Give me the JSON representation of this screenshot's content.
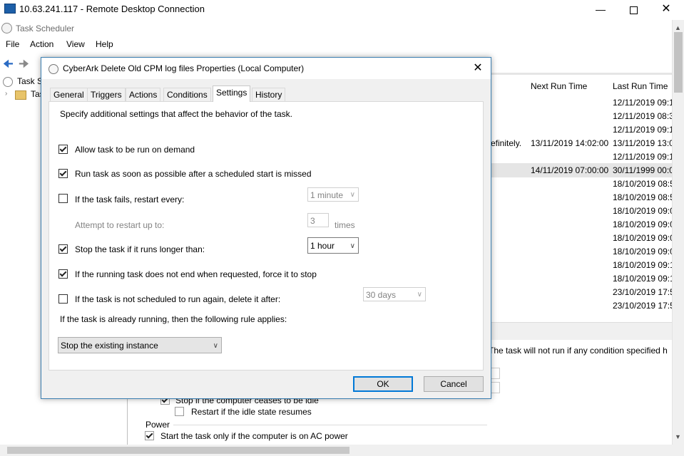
{
  "rdp": {
    "title": "10.63.241.117 - Remote Desktop Connection"
  },
  "bg": {
    "title": "Task Scheduler",
    "menu": [
      "File",
      "Action",
      "View",
      "Help"
    ],
    "tree": [
      "Task S",
      "Tas"
    ],
    "columns": {
      "next": "Next Run Time",
      "last": "Last Run Time"
    },
    "row_fragment": "efinitely.",
    "next_values": [
      "13/11/2019 14:02:00",
      "14/11/2019 07:00:00"
    ],
    "last_values": [
      "12/11/2019 09:1",
      "12/11/2019 08:3",
      "12/11/2019 09:1",
      "13/11/2019 13:0",
      "12/11/2019 09:1",
      "30/11/1999 00:0",
      "18/10/2019 08:5",
      "18/10/2019 08:5",
      "18/10/2019 09:0",
      "18/10/2019 09:0",
      "18/10/2019 09:0",
      "18/10/2019 09:0",
      "18/10/2019 09:1",
      "18/10/2019 09:1",
      "23/10/2019 17:5",
      "23/10/2019 17:5"
    ],
    "conditions_text": "The task will not run  if any condition specified h",
    "idle_stop": "Stop if the computer ceases to be idle",
    "idle_restart": "Restart if the idle state resumes",
    "power_group": "Power",
    "power_ac": "Start the task only if the computer is on AC power"
  },
  "dialog": {
    "title": "CyberArk Delete Old CPM log files Properties (Local Computer)",
    "tabs": [
      "General",
      "Triggers",
      "Actions",
      "Conditions",
      "Settings",
      "History"
    ],
    "active_tab": "Settings",
    "intro": "Specify additional settings that affect the behavior of the task.",
    "options": {
      "allow_demand": {
        "label": "Allow task to be run on demand",
        "checked": true
      },
      "run_missed": {
        "label": "Run task as soon as possible after a scheduled start is missed",
        "checked": true
      },
      "restart_fail": {
        "label": "If the task fails, restart every:",
        "checked": false,
        "value": "1 minute"
      },
      "restart_attempts": {
        "label": "Attempt to restart up to:",
        "value": "3",
        "unit": "times"
      },
      "stop_longer": {
        "label": "Stop the task if it runs longer than:",
        "checked": true,
        "value": "1 hour"
      },
      "force_stop": {
        "label": "If the running task does not end when requested, force it to stop",
        "checked": true
      },
      "delete_after": {
        "label": "If the task is not scheduled to run again, delete it after:",
        "checked": false,
        "value": "30 days"
      }
    },
    "rule_label": "If the task is already running, then the following rule applies:",
    "rule_value": "Stop the existing instance",
    "ok": "OK",
    "cancel": "Cancel"
  },
  "colors": {
    "accent": "#0078d7",
    "dialog_border": "#3c7fb1"
  }
}
